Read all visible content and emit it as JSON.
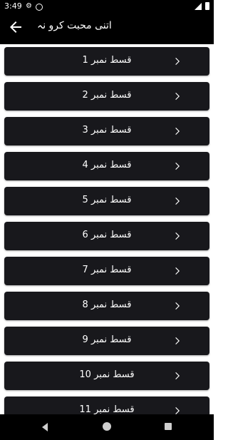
{
  "status": {
    "time": "3:49"
  },
  "appbar": {
    "title": "اتنی محبت کرو نہ"
  },
  "episodes": [
    {
      "label": "قسط نمبر 1"
    },
    {
      "label": "قسط نمبر 2"
    },
    {
      "label": "قسط نمبر 3"
    },
    {
      "label": "قسط نمبر 4"
    },
    {
      "label": "قسط نمبر 5"
    },
    {
      "label": "قسط نمبر 6"
    },
    {
      "label": "قسط نمبر 7"
    },
    {
      "label": "قسط نمبر 8"
    },
    {
      "label": "قسط نمبر 9"
    },
    {
      "label": "قسط نمبر 10"
    },
    {
      "label": "قسط نمبر 11"
    }
  ],
  "icons": {
    "back": "arrow-left-icon",
    "chevron": "chevron-right-icon",
    "settings": "gear-icon",
    "nav_back": "triangle-back-icon",
    "nav_home": "circle-home-icon",
    "nav_recents": "square-recents-icon"
  },
  "colors": {
    "background": "#ffffff",
    "item_bg": "#18181c",
    "bar_bg": "#000000",
    "text": "#ffffff"
  }
}
